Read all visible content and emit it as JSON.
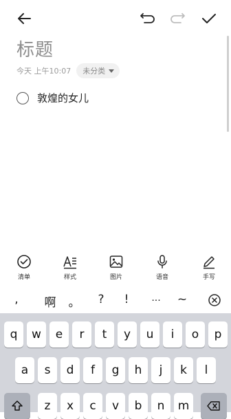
{
  "header": {
    "back_icon": "arrow-left-icon",
    "undo_icon": "undo-icon",
    "redo_icon": "redo-icon",
    "done_icon": "checkmark-icon"
  },
  "note": {
    "title_placeholder": "标题",
    "date": "今天 上午10:07",
    "category": "未分类",
    "checklist": [
      {
        "text": "敦煌的女儿",
        "checked": false
      }
    ]
  },
  "toolbar": {
    "items": [
      {
        "label": "清单",
        "icon": "checklist-icon"
      },
      {
        "label": "样式",
        "icon": "text-style-icon"
      },
      {
        "label": "图片",
        "icon": "image-icon"
      },
      {
        "label": "语音",
        "icon": "microphone-icon"
      },
      {
        "label": "手写",
        "icon": "pen-icon"
      }
    ]
  },
  "symbols": [
    ",",
    "啊",
    "。",
    "?",
    "!",
    "...",
    "~"
  ],
  "symbols_close_icon": "close-circle-icon",
  "keyboard": {
    "row1": [
      "q",
      "w",
      "e",
      "r",
      "t",
      "y",
      "u",
      "i",
      "o",
      "p"
    ],
    "row2": [
      "a",
      "s",
      "d",
      "f",
      "g",
      "h",
      "j",
      "k",
      "l"
    ],
    "row3": [
      "z",
      "x",
      "c",
      "v",
      "b",
      "n",
      "m"
    ],
    "shift_icon": "shift-icon",
    "backspace_icon": "backspace-icon"
  }
}
